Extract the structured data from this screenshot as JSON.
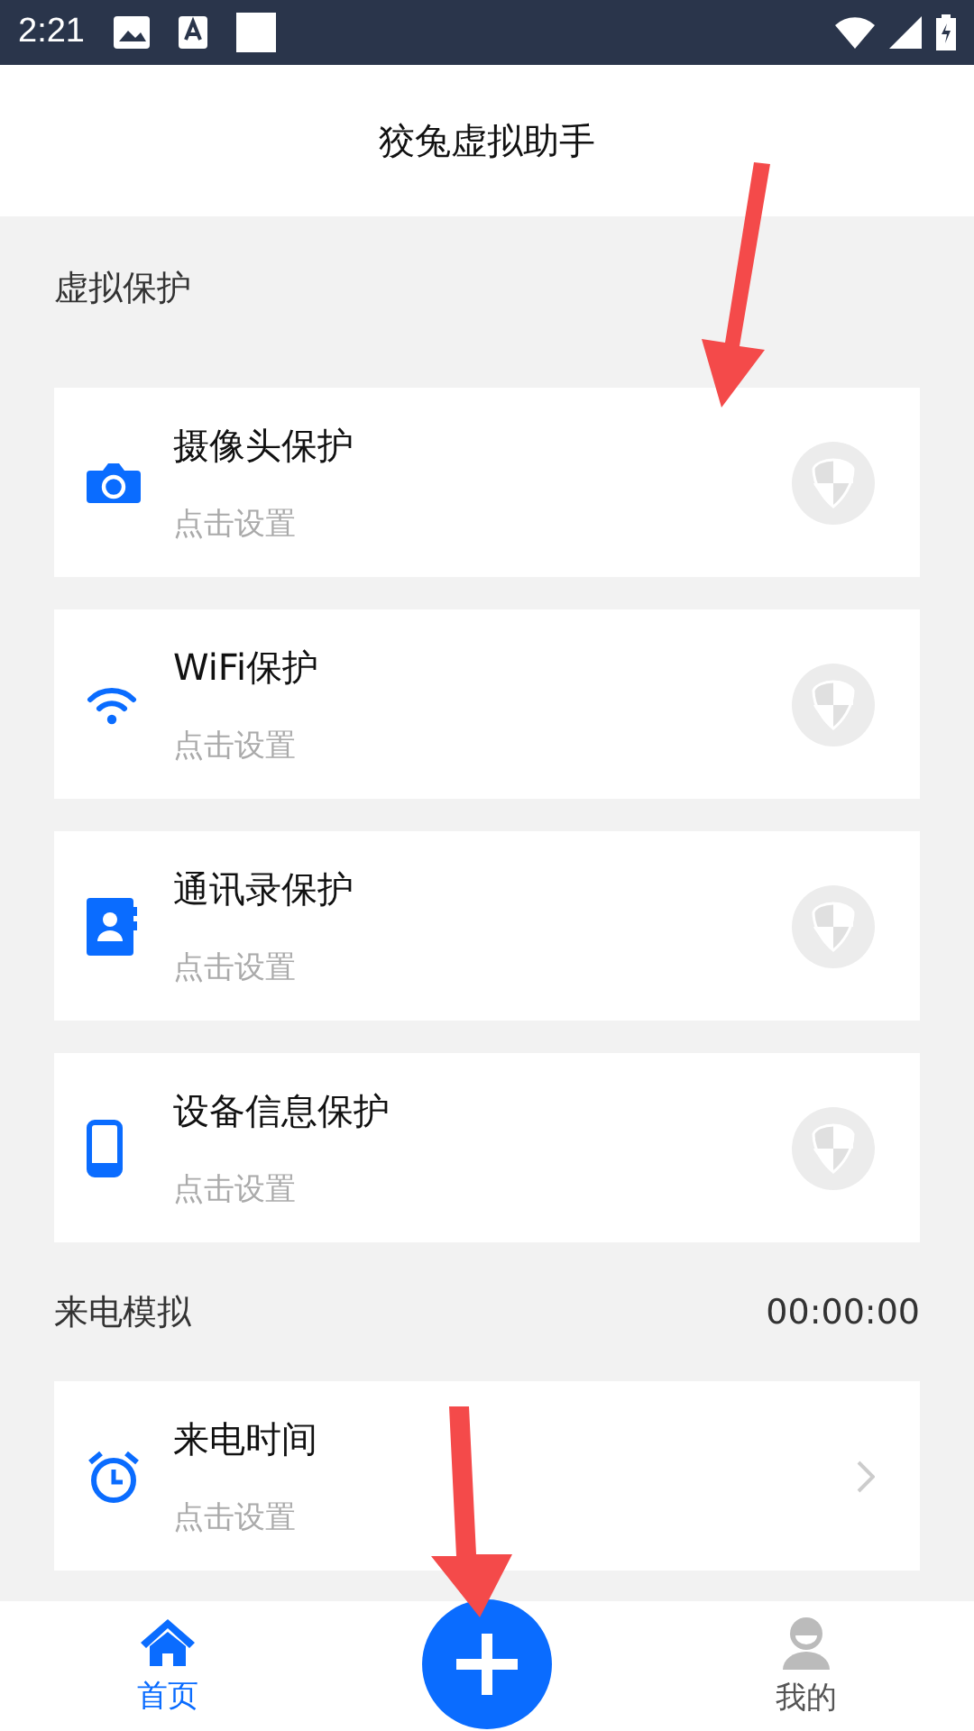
{
  "status_bar": {
    "time": "2:21"
  },
  "header": {
    "title": "狡兔虚拟助手"
  },
  "sections": [
    {
      "title": "虚拟保护",
      "items": [
        {
          "title": "摄像头保护",
          "subtitle": "点击设置",
          "kind": "shield",
          "protected": false
        },
        {
          "title": "WiFi保护",
          "subtitle": "点击设置",
          "kind": "shield",
          "protected": false
        },
        {
          "title": "通讯录保护",
          "subtitle": "点击设置",
          "kind": "shield",
          "protected": false
        },
        {
          "title": "设备信息保护",
          "subtitle": "点击设置",
          "kind": "shield",
          "protected": false
        }
      ]
    },
    {
      "title": "来电模拟",
      "value": "00:00:00",
      "items": [
        {
          "title": "来电时间",
          "subtitle": "点击设置",
          "kind": "link"
        }
      ]
    }
  ],
  "bottom_nav": [
    {
      "label": "首页",
      "selected": true
    },
    {
      "label": "我的",
      "selected": false
    }
  ]
}
